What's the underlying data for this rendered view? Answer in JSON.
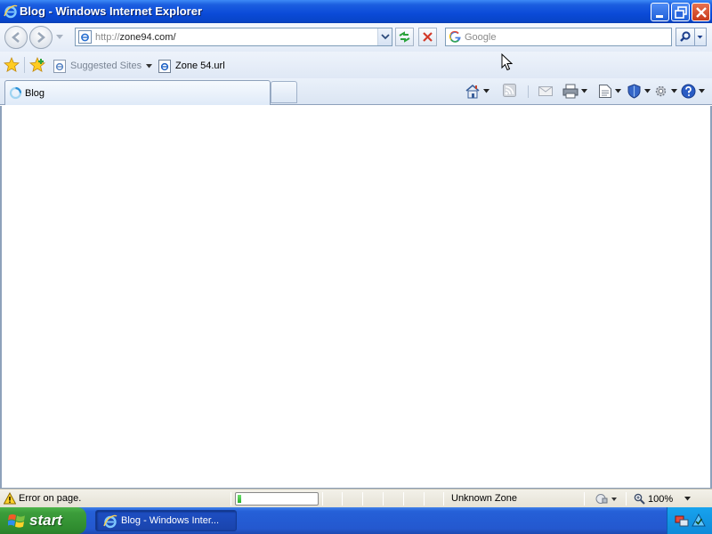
{
  "window": {
    "title": "Blog - Windows Internet Explorer",
    "icon": "ie-icon",
    "controls": [
      "minimize-icon",
      "restore-icon",
      "close-icon"
    ]
  },
  "address_bar": {
    "protocol": "http://",
    "host": "zone94.com/",
    "site_icon": "ie-page-icon"
  },
  "search": {
    "placeholder": "Google",
    "provider_icon": "google-icon",
    "go_icon": "magnifier-icon"
  },
  "favorites_bar": {
    "items": [
      {
        "label": "Suggested Sites",
        "icon": "ie-page-icon",
        "has_dropdown": true
      },
      {
        "label": "Zone 54.url",
        "icon": "ie-page-icon",
        "has_dropdown": false
      }
    ]
  },
  "tabs": [
    {
      "label": "Blog",
      "icon": "loading-icon",
      "active": true
    }
  ],
  "command_bar": [
    "home-icon",
    "feeds-icon",
    "read-mail-icon",
    "print-icon",
    "page-icon",
    "safety-icon",
    "tools-icon",
    "help-icon"
  ],
  "status_bar": {
    "message": "Error on page.",
    "progress": 0.05,
    "zone": "Unknown Zone",
    "zoom": "100%"
  },
  "taskbar": {
    "start_label": "start",
    "items": [
      {
        "label": "Blog - Windows Inter...",
        "icon": "ie-icon"
      }
    ]
  },
  "colors": {
    "titlebar": "#0a4ad8",
    "taskbar": "#2458cf",
    "start": "#3c9d3b"
  }
}
